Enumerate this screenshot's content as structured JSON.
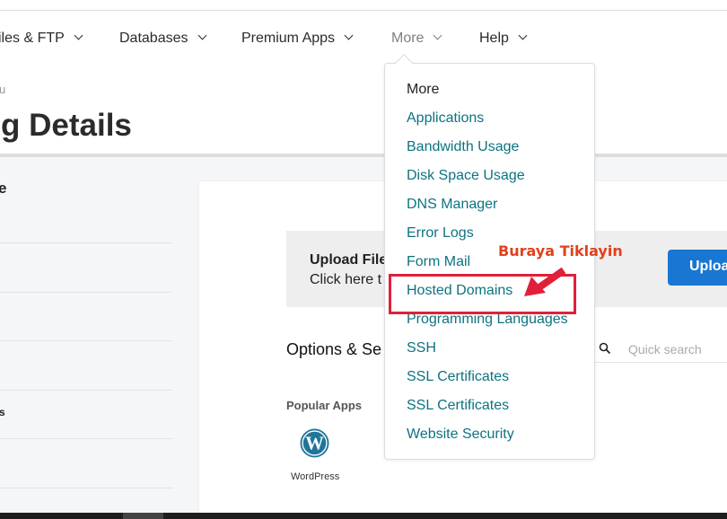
{
  "nav": {
    "items": [
      {
        "label": "iles & FTP"
      },
      {
        "label": "Databases"
      },
      {
        "label": "Premium Apps"
      },
      {
        "label": "More"
      },
      {
        "label": "Help"
      }
    ]
  },
  "breadcrumb": "u",
  "page_title": "g Details",
  "sidebar": {
    "heading": "e",
    "item_fragment": "s"
  },
  "upload": {
    "title": "Upload File",
    "subtitle": "Click here t",
    "button_label": "Uploa"
  },
  "options": {
    "title": "Options & Se",
    "search_placeholder": "Quick search"
  },
  "popular_apps": {
    "heading": "Popular Apps",
    "apps": [
      {
        "label": "WordPress",
        "icon": "wordpress-icon"
      }
    ]
  },
  "dropdown": {
    "header": "More",
    "items": [
      "Applications",
      "Bandwidth Usage",
      "Disk Space Usage",
      "DNS Manager",
      "Error Logs",
      "Form Mail",
      "Hosted Domains",
      "Programming Languages",
      "SSH",
      "SSL Certificates",
      "SSL Certificates",
      "Website Security"
    ],
    "highlighted": "Hosted Domains"
  },
  "annotation": {
    "text": "Buraya Tiklayin",
    "color": "#e2401c",
    "box_color": "#e0203a"
  },
  "colors": {
    "menu_link": "#0d7380",
    "primary_button": "#1976d2"
  }
}
